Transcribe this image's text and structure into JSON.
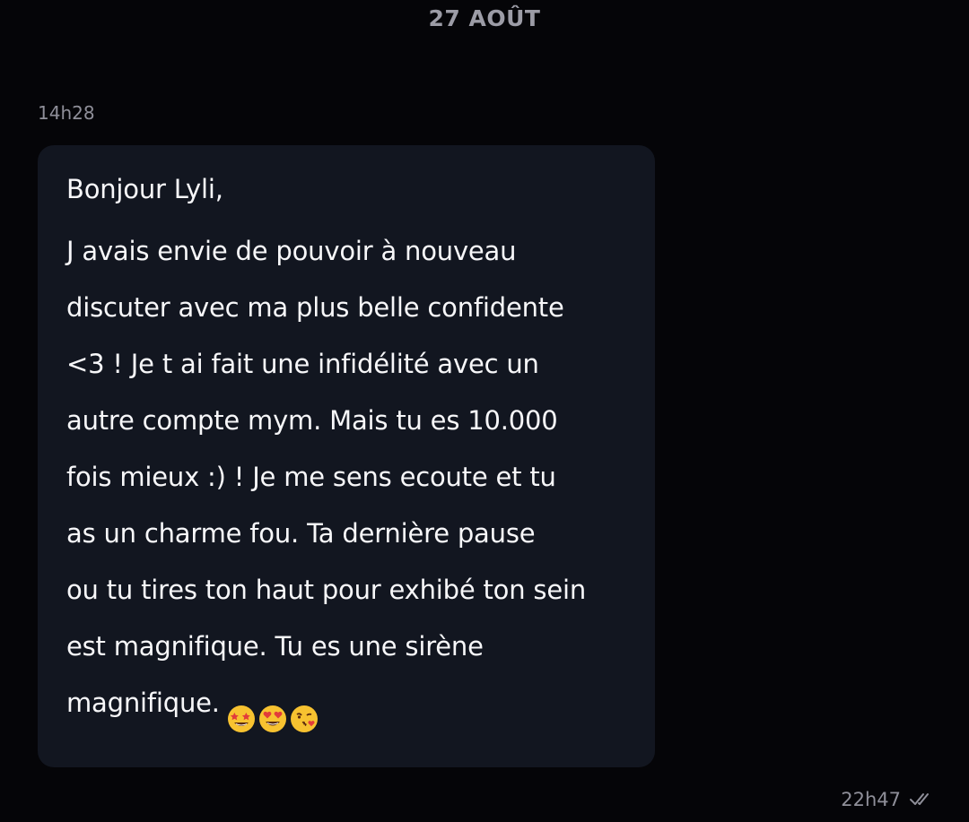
{
  "conversation": {
    "date_separator": "27 AOÛT",
    "incoming": {
      "time": "14h28",
      "lines": [
        "Bonjour Lyli,",
        "J avais envie de pouvoir à nouveau",
        "discuter avec ma plus belle confidente",
        "<3 ! Je t ai fait une infidélité avec un",
        "autre compte mym. Mais tu es 10.000",
        "fois mieux :) ! Je me sens ecoute et tu",
        "as un charme fou. Ta dernière pause",
        "ou tu tires ton haut pour exhibé ton sein",
        "est magnifique. Tu es une sirène",
        "magnifique."
      ],
      "emojis": [
        "star-struck-emoji",
        "heart-eyes-emoji",
        "kissing-heart-emoji"
      ]
    },
    "outgoing": {
      "time": "22h47",
      "status_icon": "double-check-icon"
    }
  },
  "colors": {
    "background": "#050508",
    "bubble": "#121620",
    "meta_text": "#8f8f99",
    "emoji_yellow": "#f7c230"
  }
}
